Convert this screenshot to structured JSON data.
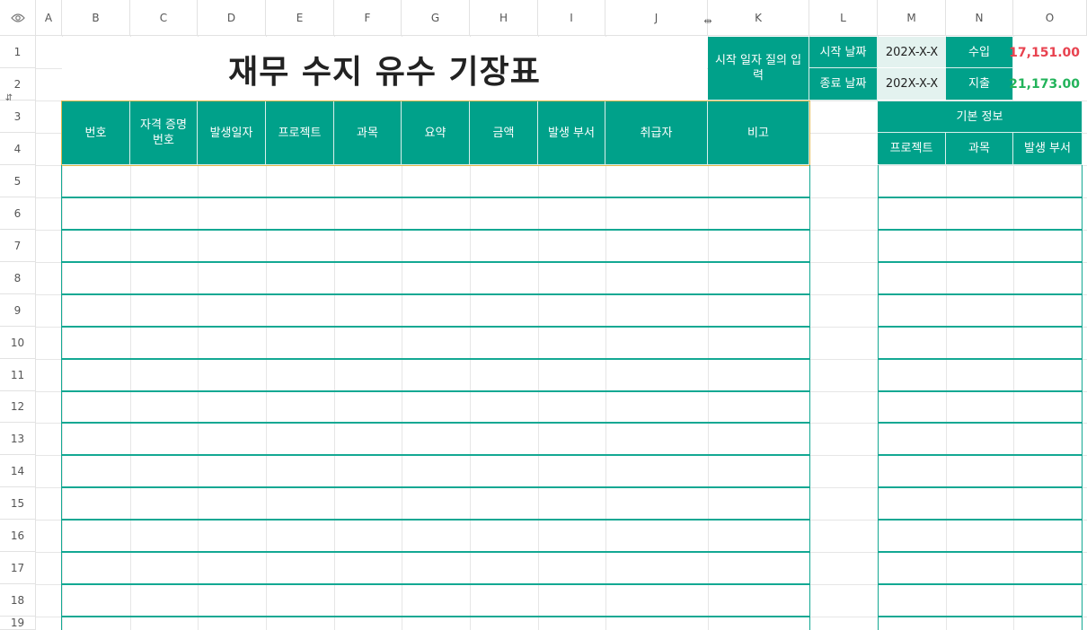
{
  "sheet": {
    "columns": [
      "A",
      "B",
      "C",
      "D",
      "E",
      "F",
      "G",
      "H",
      "I",
      "J",
      "K",
      "L",
      "M",
      "N",
      "O"
    ],
    "rows": [
      "1",
      "2",
      "3",
      "4",
      "5",
      "6",
      "7",
      "8",
      "9",
      "10",
      "11",
      "12",
      "13",
      "14",
      "15",
      "16",
      "17",
      "18",
      "19"
    ]
  },
  "title": "재무 수지 유수 기장표",
  "date_input_label": "시작 일자 질의 입력",
  "start_date_label": "시작 날짜",
  "end_date_label": "종료 날짜",
  "start_date_value": "202X-X-X",
  "end_date_value": "202X-X-X",
  "income_label": "수입",
  "expense_label": "지출",
  "income_value": "17,151.00",
  "expense_value": "21,173.00",
  "table_headers": [
    "번호",
    "자격 증명\n번호",
    "발생일자",
    "프로젝트",
    "과목",
    "요약",
    "금액",
    "발생 부서",
    "취급자",
    "비고"
  ],
  "basic_info": {
    "title": "기본 정보",
    "headers": [
      "프로젝트",
      "과목",
      "발생 부서"
    ]
  },
  "colors": {
    "accent": "#00a18a",
    "income": "#e8424f",
    "expense": "#22b35a",
    "light_fill": "#e3f2ef"
  }
}
